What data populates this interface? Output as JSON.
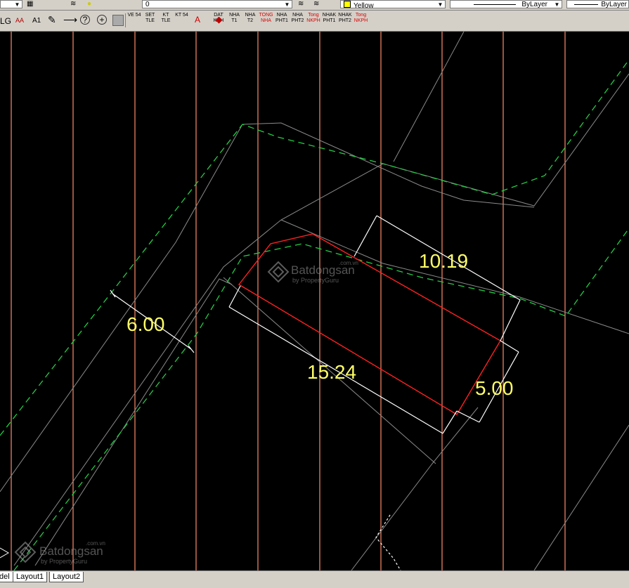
{
  "toolbar": {
    "layer_value": "0",
    "color_value": "Yellow",
    "linetype_value": "ByLayer",
    "lineweight_value": "ByLayer",
    "text_tools": [
      "LG",
      "AA",
      "A1"
    ],
    "custom_buttons": [
      {
        "label": "VE 54",
        "red": false
      },
      {
        "label": "SET TLE",
        "red": false
      },
      {
        "label": "KT TLE",
        "red": false
      },
      {
        "label": "KT 54",
        "red": false
      },
      {
        "label": "DAT KPH",
        "red": false
      },
      {
        "label": "NHA T1",
        "red": false
      },
      {
        "label": "NHA T2",
        "red": false
      },
      {
        "label": "TONG NHA",
        "red": true
      },
      {
        "label": "NHA PHT1",
        "red": false
      },
      {
        "label": "NHA PHT2",
        "red": false
      },
      {
        "label": "Tong NKPH",
        "red": true
      },
      {
        "label": "NHAK PHT1",
        "red": false
      },
      {
        "label": "NHAK PHT2",
        "red": false
      },
      {
        "label": "Tong NKPH",
        "red": true
      }
    ]
  },
  "drawing": {
    "dimensions": [
      "6.00",
      "15.24",
      "10.19",
      "5.00"
    ],
    "colors": {
      "background": "#000000",
      "grid": "#ff8c69",
      "boundary": "#ff2020",
      "dimension": "#ffffff",
      "dashed": "#22cc44",
      "text": "#ffff66"
    }
  },
  "watermark": {
    "brand": "Batdongsan",
    "sub": "by PropertyGuru",
    "domain": ".com.vn"
  },
  "tabs": [
    "del",
    "Layout1",
    "Layout2"
  ]
}
